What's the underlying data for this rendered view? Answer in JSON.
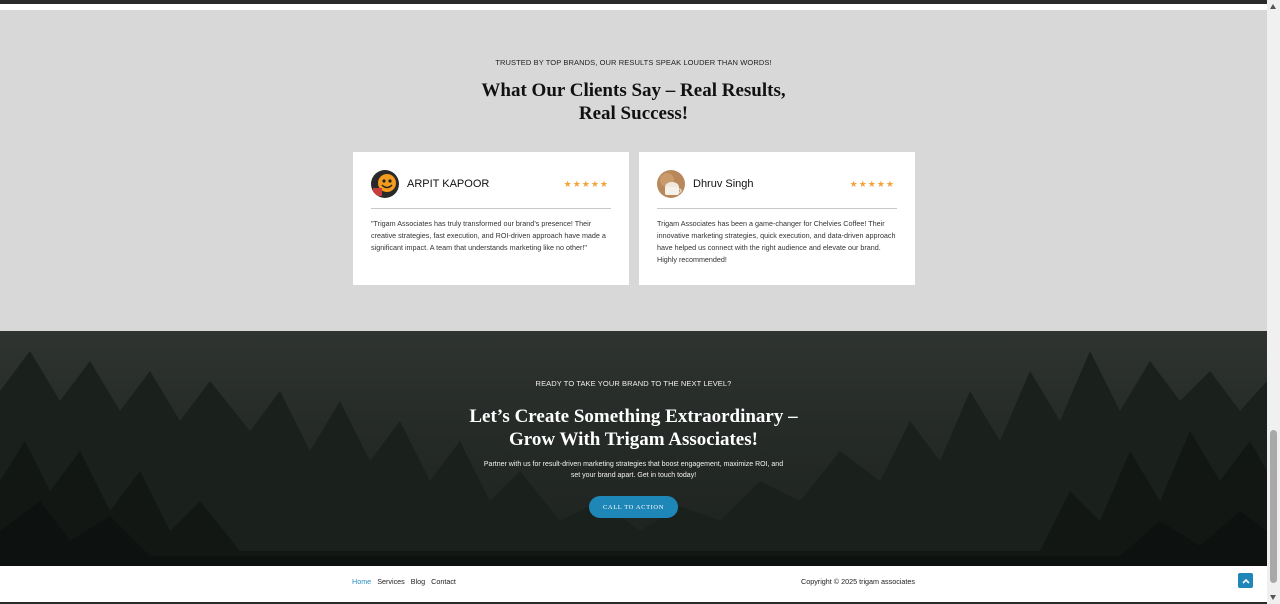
{
  "testimonials": {
    "eyebrow": "TRUSTED BY TOP BRANDS, OUR RESULTS SPEAK LOUDER THAN WORDS!",
    "heading_line1": "What Our Clients Say – Real Results,",
    "heading_line2": "Real Success!",
    "cards": [
      {
        "name": "ARPIT KAPOOR",
        "stars": "★★★★★",
        "rating": 5,
        "quote": "\"Trigam Associates has truly transformed our brand’s presence! Their creative strategies, fast execution, and ROI-driven approach have made a significant impact. A team that understands marketing like no other!\""
      },
      {
        "name": "Dhruv Singh",
        "stars": "★★★★★",
        "rating": 5,
        "quote": "Trigam Associates has been a game-changer for Chelvies Coffee! Their innovative marketing strategies, quick execution, and data-driven approach have helped us connect with the right audience and elevate our brand. Highly recommended!"
      }
    ]
  },
  "cta": {
    "eyebrow": "READY TO TAKE YOUR BRAND TO THE NEXT LEVEL?",
    "heading_line1": "Let’s Create Something Extraordinary –",
    "heading_line2": "Grow With Trigam Associates!",
    "sub_line1": "Partner with us for result-driven marketing strategies that boost engagement, maximize ROI, and",
    "sub_line2": "set your brand apart. Get in touch today!",
    "button_label": "CALL TO ACTION"
  },
  "footer": {
    "nav": [
      "Home",
      "Services",
      "Blog",
      "Contact"
    ],
    "active": "Home",
    "copyright": "Copyright © 2025 trigam associates"
  },
  "colors": {
    "accent": "#1f86b8",
    "stars": "#f2a33a",
    "section_bg": "#d8d8d8"
  },
  "icons": {
    "scroll_top": "chevron-up-icon",
    "rating": "star-icon"
  }
}
